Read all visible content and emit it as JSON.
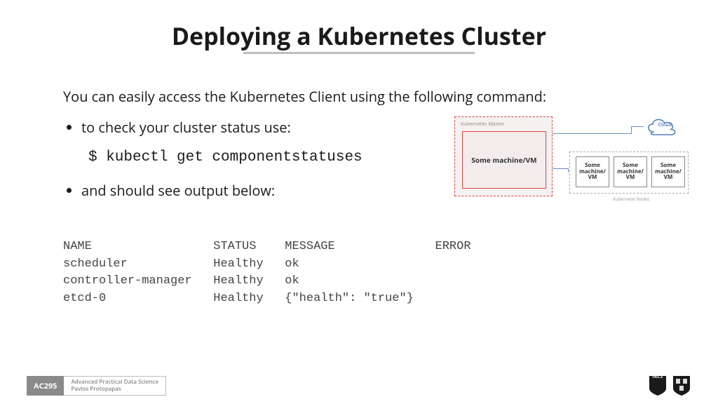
{
  "title": "Deploying a Kubernetes Cluster",
  "intro": "You can easily access the Kubernetes Client using the following command:",
  "bullet1": "to check your cluster status use:",
  "command": "$ kubectl get componentstatuses",
  "bullet2": "and should see output below:",
  "diagram": {
    "master_label": "Kubernetes Master",
    "master_inner": "Some machine/VM",
    "cloud": "Cloud",
    "nodes_label": "Kubernetes Nodes",
    "node": "Some machine/ VM"
  },
  "table": {
    "headers": {
      "name": "NAME",
      "status": "STATUS",
      "message": "MESSAGE",
      "error": "ERROR"
    },
    "rows": [
      {
        "name": "scheduler",
        "status": "Healthy",
        "message": "ok",
        "error": ""
      },
      {
        "name": "controller-manager",
        "status": "Healthy",
        "message": "ok",
        "error": ""
      },
      {
        "name": "etcd-0",
        "status": "Healthy",
        "message": "{\"health\": \"true\"}",
        "error": ""
      }
    ]
  },
  "footer": {
    "code": "AC295",
    "line1": "Advanced Practical Data Science",
    "line2": "Pavlos Protopapas"
  },
  "logos": {
    "iacs": "IACS"
  }
}
